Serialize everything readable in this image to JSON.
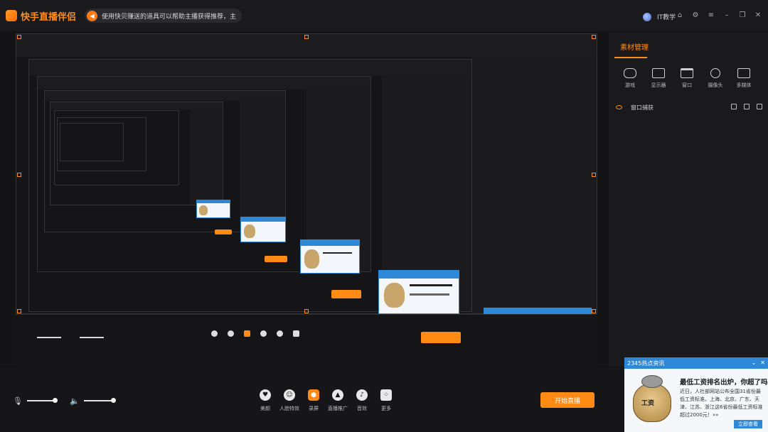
{
  "app": {
    "title": "快手直播伴侣"
  },
  "notice": {
    "text": "使用快贝赚送的道具可以帮助主播获得推荐，主"
  },
  "user": {
    "name": "IT教学"
  },
  "window_controls": [
    "home-icon",
    "gear-icon",
    "menu-icon",
    "minimize-icon",
    "restore-icon",
    "close-icon"
  ],
  "panel": {
    "tab": "素材管理",
    "sources": [
      {
        "label": "游戏",
        "icon": "gamepad-icon"
      },
      {
        "label": "显示器",
        "icon": "monitor-icon"
      },
      {
        "label": "窗口",
        "icon": "window-icon"
      },
      {
        "label": "摄像头",
        "icon": "camera-icon"
      },
      {
        "label": "多媒体",
        "icon": "media-icon"
      }
    ],
    "layers": [
      {
        "name": "窗口捕获"
      }
    ]
  },
  "toolbar": {
    "tools": [
      {
        "label": "美颜",
        "icon": "beauty-icon",
        "active": false
      },
      {
        "label": "人脸特效",
        "icon": "face-effect-icon",
        "active": false
      },
      {
        "label": "录屏",
        "icon": "record-icon",
        "active": true
      },
      {
        "label": "直播推广",
        "icon": "promote-icon",
        "active": false
      },
      {
        "label": "音效",
        "icon": "music-icon",
        "active": false
      },
      {
        "label": "更多",
        "icon": "more-icon",
        "active": false
      }
    ],
    "start_label": "开始直播"
  },
  "popup": {
    "header": "2345热点资讯",
    "title": "最低工资排名出炉，你超了吗?",
    "body": "近日，人社部网站公布全国31省份最低工资标准。上海、北京、广东、天津、江苏、浙江这6省份最低工资标准超过2000元！»»",
    "pic_text": "工资",
    "link": "立即查看"
  },
  "colors": {
    "accent": "#ff8a14",
    "popup_blue": "#2d89d8"
  }
}
